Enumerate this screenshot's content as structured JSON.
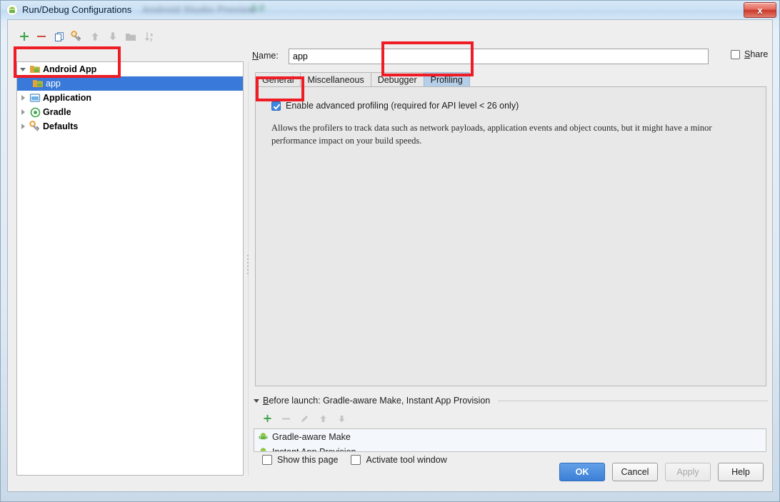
{
  "window": {
    "title": "Run/Debug Configurations",
    "title_icon": "android-icon",
    "close_label": "x",
    "blurred_bg_1": "Android Studio Preview",
    "blurred_bg_2": "3.0"
  },
  "tree_toolbar": {
    "buttons": [
      {
        "name": "add-configuration-button",
        "icon": "plus-icon",
        "label": "+"
      },
      {
        "name": "remove-configuration-button",
        "icon": "minus-icon",
        "label": "−"
      },
      {
        "name": "copy-configuration-button",
        "icon": "copy-icon",
        "label": ""
      },
      {
        "name": "edit-defaults-button",
        "icon": "wrench-icon",
        "label": ""
      },
      {
        "name": "move-up-button",
        "icon": "arrow-up-icon",
        "label": ""
      },
      {
        "name": "move-down-button",
        "icon": "arrow-down-icon",
        "label": ""
      },
      {
        "name": "move-into-folder-button",
        "icon": "folder-icon",
        "label": ""
      },
      {
        "name": "sort-alphabetically-button",
        "icon": "sort-az-icon",
        "label": ""
      }
    ]
  },
  "tree": {
    "nodes": [
      {
        "label": "Android App",
        "icon": "android-app-icon",
        "expanded": true,
        "selected": false,
        "child": false
      },
      {
        "label": "app",
        "icon": "android-app-icon",
        "expanded": false,
        "selected": true,
        "child": true
      },
      {
        "label": "Application",
        "icon": "application-icon",
        "expanded": false,
        "selected": false,
        "child": false
      },
      {
        "label": "Gradle",
        "icon": "gradle-icon",
        "expanded": false,
        "selected": false,
        "child": false
      },
      {
        "label": "Defaults",
        "icon": "wrench-icon",
        "expanded": false,
        "selected": false,
        "child": false
      }
    ]
  },
  "name_row": {
    "label": "Name:",
    "label_mnemonic": "N",
    "value": "app",
    "placeholder": "",
    "share_label": "Share",
    "share_mnemonic": "S",
    "share_checked": false
  },
  "tabs": [
    {
      "label": "General",
      "active": false
    },
    {
      "label": "Miscellaneous",
      "active": false
    },
    {
      "label": "Debugger",
      "active": false
    },
    {
      "label": "Profiling",
      "active": true
    }
  ],
  "profiling": {
    "checkbox_label": "Enable advanced profiling (required for API level < 26 only)",
    "checkbox_checked": true,
    "description": "Allows the profilers to track data such as network payloads, application events and object counts, but it might have a minor performance impact on your build speeds."
  },
  "before_launch": {
    "title": "Before launch: Gradle-aware Make, Instant App Provision",
    "title_mnemonic": "B",
    "expanded": true,
    "toolbar": [
      {
        "name": "add-task-button",
        "icon": "plus-icon",
        "enabled": true
      },
      {
        "name": "remove-task-button",
        "icon": "minus-icon",
        "enabled": false
      },
      {
        "name": "edit-task-button",
        "icon": "pencil-icon",
        "enabled": false
      },
      {
        "name": "move-task-up-button",
        "icon": "arrow-up-icon",
        "enabled": false
      },
      {
        "name": "move-task-down-button",
        "icon": "arrow-down-icon",
        "enabled": false
      }
    ],
    "items": [
      {
        "label": "Gradle-aware Make",
        "icon": "android-icon"
      },
      {
        "label": "Instant App Provision",
        "icon": "android-icon"
      }
    ]
  },
  "bottom_checks": [
    {
      "label": "Show this page",
      "checked": false
    },
    {
      "label": "Activate tool window",
      "checked": false
    }
  ],
  "dialog_buttons": [
    {
      "label": "OK",
      "style": "primary"
    },
    {
      "label": "Cancel",
      "style": "normal"
    },
    {
      "label": "Apply",
      "style": "disabled"
    },
    {
      "label": "Help",
      "style": "normal"
    }
  ],
  "annotations": [
    {
      "name": "annotation-tree",
      "color": "#EE1C25"
    },
    {
      "name": "annotation-profiling-tab",
      "color": "#EE1C25"
    },
    {
      "name": "annotation-enable-checkbox",
      "color": "#EE1C25"
    }
  ]
}
